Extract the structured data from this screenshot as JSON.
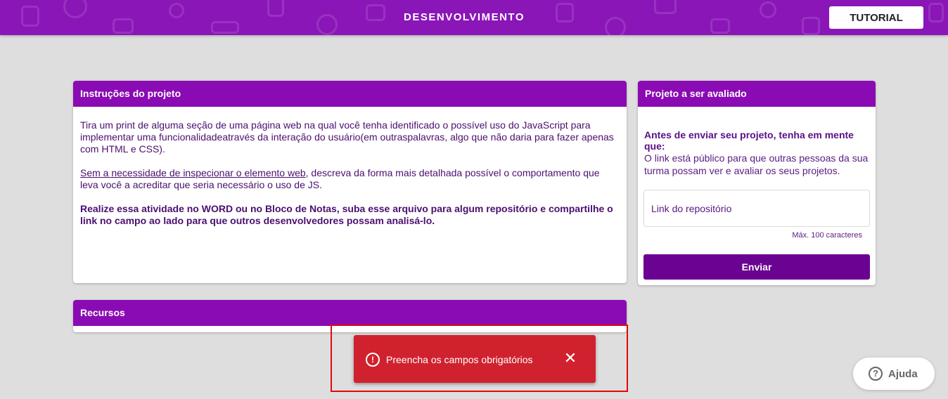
{
  "header": {
    "title": "DESENVOLVIMENTO",
    "tutorial_label": "TUTORIAL",
    "background_color": "#8a16b8"
  },
  "instructions": {
    "title": "Instruções do projeto",
    "paragraph1": "Tira um print de alguma seção de uma página web na qual você tenha identificado o possível uso do JavaScript para implementar uma funcionalidadeatravés da interação do usuário(em outraspalavras, algo que não daria para fazer apenas com HTML e CSS).",
    "paragraph2_link": "Sem a necessidade de inspecionar o elemento web",
    "paragraph2_rest": ", descreva da forma mais detalhada possível o comportamento que leva você a acreditar que seria necessário o uso de JS.",
    "paragraph3": "Realize essa atividade no WORD ou no Bloco de Notas, suba esse arquivo para algum repositório e compartilhe o link no campo ao lado para que outros desenvolvedores possam analisá-lo."
  },
  "project": {
    "title": "Projeto a ser avaliado",
    "hint_title": "Antes de enviar seu projeto, tenha em mente que:",
    "hint": "O link está público para que outras pessoas da sua turma possam ver e avaliar os seus projetos.",
    "repo_placeholder": "Link do repositório",
    "repo_value": "",
    "max_chars": "Máx. 100 caracteres",
    "send_label": "Enviar"
  },
  "resources": {
    "title": "Recursos"
  },
  "toast": {
    "message": "Preencha os campos obrigatórios",
    "warn_glyph": "!",
    "close_glyph": "✕",
    "color": "#d0222e"
  },
  "help": {
    "label": "Ajuda",
    "glyph": "?"
  },
  "icons": [
    "warning-icon",
    "close-icon",
    "help-icon"
  ]
}
